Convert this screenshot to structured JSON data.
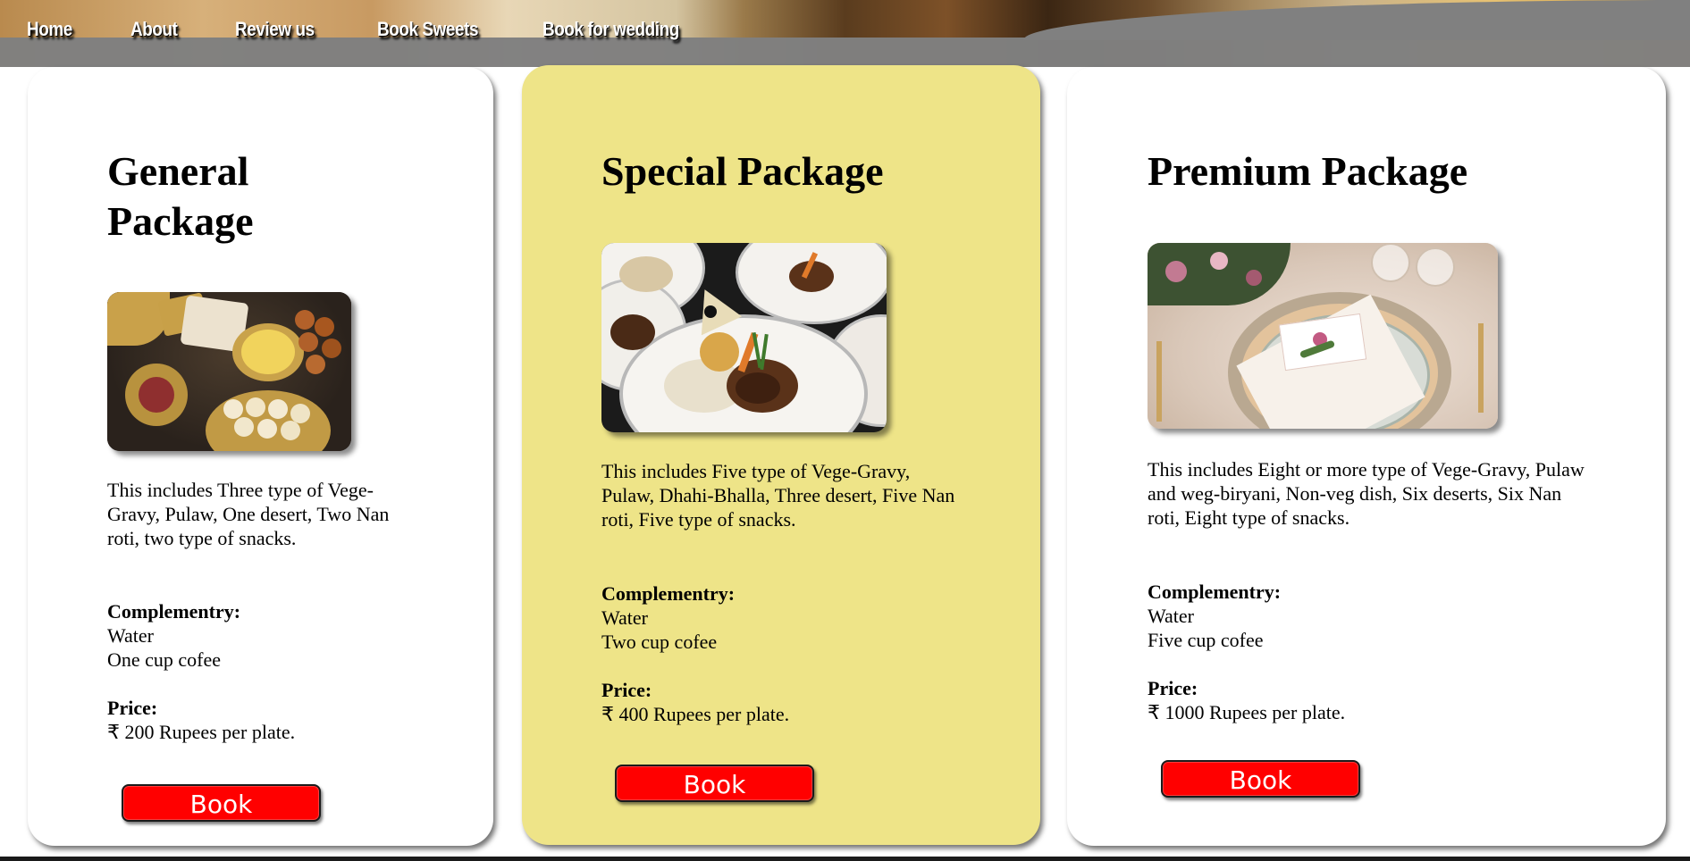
{
  "nav": {
    "items": [
      "Home",
      "About",
      "Review us",
      "Book Sweets",
      "Book for wedding"
    ]
  },
  "packages": [
    {
      "title": "General Package",
      "photo_icon": "sweets-platter-photo",
      "description": "This includes Three type of Vege-Gravy, Pulaw, One desert, Two Nan roti, two type of snacks.",
      "complementary_label": "Complementry:",
      "complementary_items": [
        "Water",
        "One cup cofee"
      ],
      "price_label": "Price:",
      "price_text": "₹ 200 Rupees per plate.",
      "button_label": "Book"
    },
    {
      "title": "Special Package",
      "photo_icon": "plated-dinner-photo",
      "description": "This includes Five type of Vege-Gravy, Pulaw, Dhahi-Bhalla, Three desert, Five Nan roti, Five type of snacks.",
      "complementary_label": "Complementry:",
      "complementary_items": [
        "Water",
        "Two cup cofee"
      ],
      "price_label": "Price:",
      "price_text": "₹ 400 Rupees per plate.",
      "button_label": "Book"
    },
    {
      "title": "Premium Package",
      "photo_icon": "wedding-table-setting-photo",
      "description": "This includes Eight or more type of Vege-Gravy, Pulaw and weg-biryani, Non-veg dish, Six deserts, Six Nan roti, Eight type of snacks.",
      "complementary_label": "Complementry:",
      "complementary_items": [
        "Water",
        "Five cup cofee"
      ],
      "price_label": "Price:",
      "price_text": "₹ 1000 Rupees per plate.",
      "button_label": "Book"
    }
  ],
  "colors": {
    "special_card_bg": "#eee488",
    "book_button": "#ff0000",
    "nav_bar": "#808080"
  }
}
